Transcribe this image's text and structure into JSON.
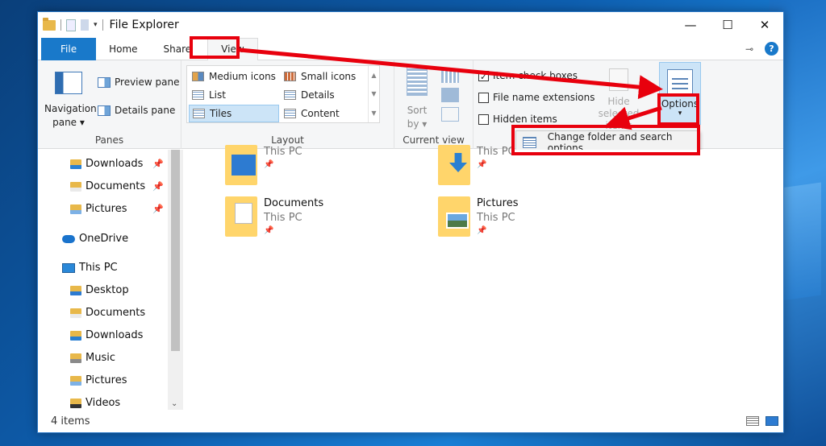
{
  "window": {
    "title": "File Explorer",
    "minimize": "—",
    "maximize": "☐",
    "close": "✕",
    "qat_dropdown": "▾"
  },
  "tabs": {
    "file": "File",
    "home": "Home",
    "share": "Share",
    "view": "View",
    "help": "?"
  },
  "ribbon": {
    "panes": {
      "label": "Panes",
      "nav_pane": "Navigation pane ▾",
      "preview_pane": "Preview pane",
      "details_pane": "Details pane"
    },
    "layout": {
      "label": "Layout",
      "items": [
        "Medium icons",
        "Small icons",
        "List",
        "Details",
        "Tiles",
        "Content"
      ],
      "selected": "Tiles"
    },
    "current_view": {
      "label": "Current view",
      "sort_by": "Sort by ▾"
    },
    "show_hide": {
      "item_check_boxes": "Item check boxes",
      "file_name_extensions": "File name extensions",
      "hidden_items": "Hidden items",
      "hide_selected_items": "Hide selected items"
    },
    "options": {
      "label": "Options",
      "arrow": "▾"
    }
  },
  "dropdown": {
    "change_folder": "Change folder and search options"
  },
  "navigation": {
    "quick_access": [
      {
        "label": "Downloads",
        "pinned": true
      },
      {
        "label": "Documents",
        "pinned": true
      },
      {
        "label": "Pictures",
        "pinned": true
      }
    ],
    "onedrive": "OneDrive",
    "this_pc": "This PC",
    "this_pc_items": [
      "Desktop",
      "Documents",
      "Downloads",
      "Music",
      "Pictures",
      "Videos"
    ]
  },
  "content": {
    "tiles": [
      {
        "name": "",
        "location": "This PC"
      },
      {
        "name": "",
        "location": "This PC"
      },
      {
        "name": "Documents",
        "location": "This PC"
      },
      {
        "name": "Pictures",
        "location": "This PC"
      }
    ]
  },
  "status": {
    "item_count": "4 items"
  },
  "colors": {
    "annotation": "#e8000d",
    "accent": "#1979ca",
    "selection": "#cce4f7"
  }
}
